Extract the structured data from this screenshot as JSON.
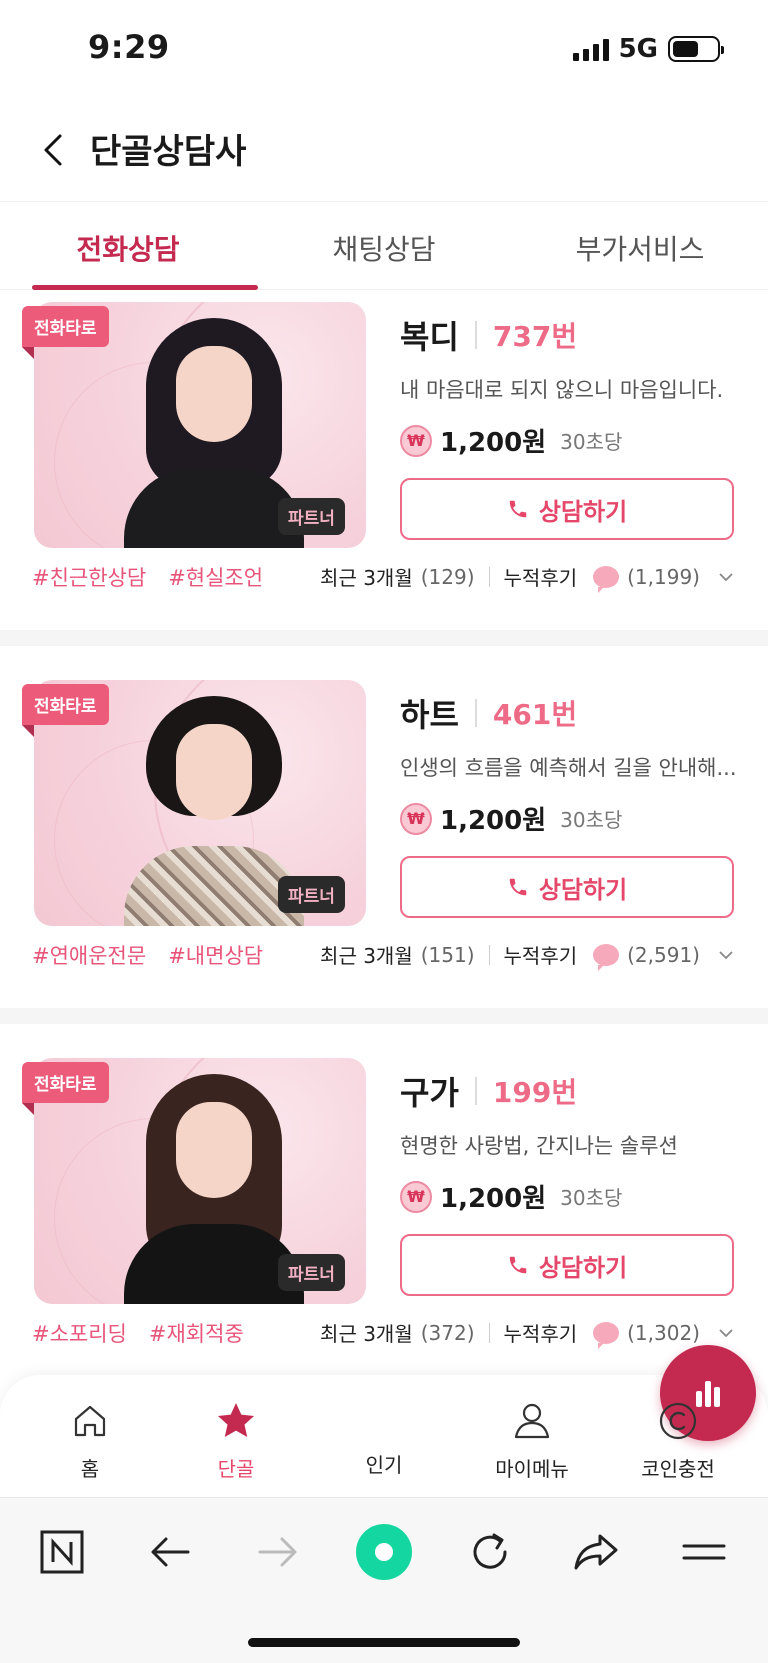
{
  "status_bar": {
    "time": "9:29",
    "network": "5G",
    "battery_level": 0.6
  },
  "header": {
    "title": "단골상담사"
  },
  "tabs": [
    {
      "label": "전화상담",
      "active": true
    },
    {
      "label": "채팅상담",
      "active": false
    },
    {
      "label": "부가서비스",
      "active": false
    }
  ],
  "counselors": [
    {
      "type_badge": "전화타로",
      "partner_badge": "파트너",
      "name": "복디",
      "number": "737번",
      "description": "내 마음대로 되지 않으니 마음입니다.",
      "price": "1,200원",
      "price_unit": "30초당",
      "consult_label": "상담하기",
      "tags": [
        "#친근한상담",
        "#현실조언"
      ],
      "recent_label": "최근 3개월",
      "recent_count": "(129)",
      "reviews_label": "누적후기",
      "reviews_count": "(1,199)"
    },
    {
      "type_badge": "전화타로",
      "partner_badge": "파트너",
      "name": "하트",
      "number": "461번",
      "description": "인생의 흐름을 예측해서 길을 안내해...",
      "price": "1,200원",
      "price_unit": "30초당",
      "consult_label": "상담하기",
      "tags": [
        "#연애운전문",
        "#내면상담"
      ],
      "recent_label": "최근 3개월",
      "recent_count": "(151)",
      "reviews_label": "누적후기",
      "reviews_count": "(2,591)"
    },
    {
      "type_badge": "전화타로",
      "partner_badge": "파트너",
      "name": "구가",
      "number": "199번",
      "description": "현명한 사랑법, 간지나는 솔루션",
      "price": "1,200원",
      "price_unit": "30초당",
      "consult_label": "상담하기",
      "tags": [
        "#소포리딩",
        "#재회적중"
      ],
      "recent_label": "최근 3개월",
      "recent_count": "(372)",
      "reviews_label": "누적후기",
      "reviews_count": "(1,302)"
    }
  ],
  "bottom_nav": [
    {
      "label": "홈",
      "icon": "home-icon",
      "active": false
    },
    {
      "label": "단골",
      "icon": "star-icon",
      "active": true
    },
    {
      "label": "인기",
      "icon": "bar-chart-icon",
      "active": false
    },
    {
      "label": "마이메뉴",
      "icon": "person-icon",
      "active": false
    },
    {
      "label": "코인충전",
      "icon": "coin-c-icon",
      "active": false
    }
  ],
  "colors": {
    "accent": "#c42a4f",
    "pink": "#ee6b88",
    "tag": "#e8557a"
  }
}
